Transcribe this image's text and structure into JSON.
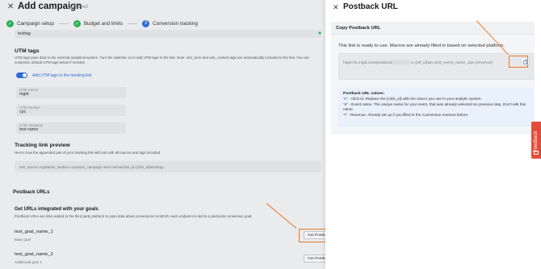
{
  "background": {
    "title": "Add campaign",
    "saved": "Saved",
    "steps": [
      {
        "label": "Campaign setup",
        "state": "done"
      },
      {
        "label": "Budget and limits",
        "state": "done"
      },
      {
        "label": "Conversion tracking",
        "state": "active",
        "number": "3"
      }
    ],
    "top_field_value": "testtag",
    "utm": {
      "title": "UTM tags",
      "description": "UTM tags pass data to the external analytical system. Turn the switcher on to add UTM tags to the link. Note: utm_term and utm_content tags are automatically included to the link. You can customize default UTM tags below if needed.",
      "toggle_label": "Add UTM tags to the tracking link",
      "fields": [
        {
          "label": "UTM source",
          "value": "mgid"
        },
        {
          "label": "UTM medium",
          "value": "cpc"
        },
        {
          "label": "UTM campaign",
          "value": "test name"
        }
      ]
    },
    "preview": {
      "title": "Tracking link preview",
      "description": "Here's how the appended part of your tracking link will look with all macros and tags included",
      "value": "utm_source=mgid&utm_medium=cpc&utm_campaign=test+name&click_id={click_id}&testtag="
    },
    "postback": {
      "title": "Postback URLs",
      "subtitle": "Get URLs integrated with your goals",
      "description": "Postback URLs are links added to the third party platform to pass data about conversions to MGID, each endpoint is tied to a particular conversion goal",
      "goals": [
        {
          "name": "test_goal_name_1",
          "sub": "Main goal",
          "button": "Get Postback URL"
        },
        {
          "name": "test_goal_name_2",
          "sub": "Additional goal 1",
          "button": "Get Postback URL"
        }
      ]
    }
  },
  "drawer": {
    "title": "Postback URL",
    "section_title": "Copy Postback URL",
    "ready_text": "This link is ready to use. Macros are already filled in based on selected platform.",
    "url_prefix": "https://a.mgid.com/postback",
    "url_suffix": "c={ref_id}&e=test_event_name_1&r={revenue}",
    "values": {
      "title": "Postback URL values:",
      "items": [
        "\"c\" - Click id. Replace the {click_id} with the macro you use in your analytic system.",
        "\"e\" - Event name. The unique name for your event, that was already selected on previous step. Don't edit this name.",
        "\"r\" - Revenue. Already set up if you filled in the Conversion revenue before."
      ]
    }
  },
  "feedback_label": "Feedback",
  "icons": {
    "close": "close-icon",
    "check": "check-icon",
    "copy": "copy-icon",
    "feedback": "chat-icon"
  },
  "colors": {
    "accent": "#2f6fe0",
    "success": "#2eb85c",
    "annotation": "#f07c22",
    "feedback": "#e24d3b"
  }
}
